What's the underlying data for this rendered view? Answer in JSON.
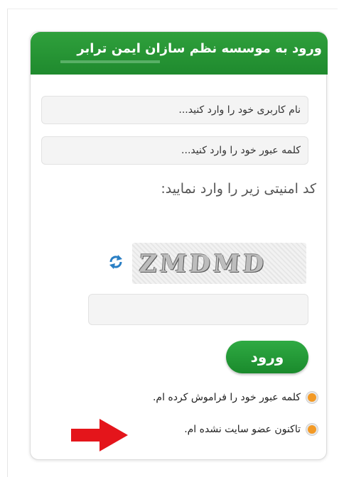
{
  "header": {
    "title": "ورود به موسسه نظم سازان ایمن ترابر"
  },
  "form": {
    "username_placeholder": "نام کاربری خود را وارد کنید...",
    "password_placeholder": "کلمه عبور خود را وارد کنید...",
    "security_label": "کد امنیتی زیر را وارد نمایید:",
    "captcha_text": "ZMDMD",
    "login_label": "ورود"
  },
  "links": {
    "forgot_password": "کلمه عبور خود را فراموش کرده ام.",
    "not_member": "تاکنون عضو سایت نشده ام."
  },
  "colors": {
    "accent_green": "#22953a",
    "bullet_orange": "#f39a26",
    "arrow_red": "#e4151b"
  },
  "icons": {
    "refresh": "refresh-icon",
    "arrow": "arrow-right-icon"
  }
}
